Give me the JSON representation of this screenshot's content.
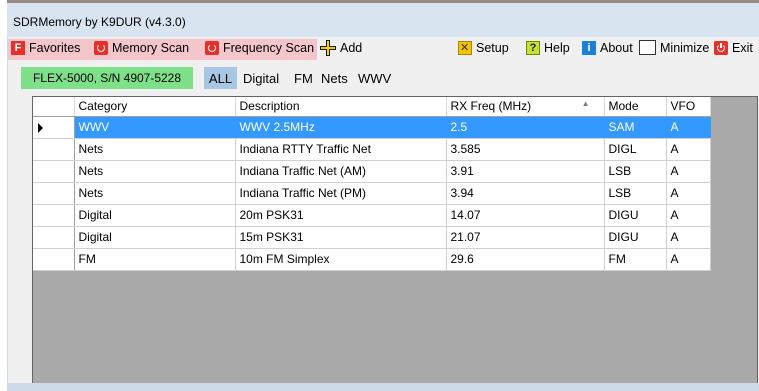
{
  "window": {
    "title": "SDRMemory by K9DUR (v4.3.0)"
  },
  "menu": {
    "favorites": "Favorites",
    "favorites_icon_letter": "F",
    "memory_scan": "Memory Scan",
    "frequency_scan": "Frequency Scan",
    "add": "Add",
    "setup": "Setup",
    "help": "Help",
    "help_icon_letter": "?",
    "about": "About",
    "about_icon_letter": "i",
    "minimize": "Minimize",
    "exit": "Exit"
  },
  "radio": {
    "label": "FLEX-5000, S/N 4907-5228"
  },
  "filters": [
    "ALL",
    "Digital",
    "FM",
    "Nets",
    "WWV"
  ],
  "grid": {
    "columns": [
      "Category",
      "Description",
      "RX Freq (MHz)",
      "Mode",
      "VFO"
    ],
    "sort_indicator": "▲",
    "rows": [
      {
        "category": "WWV",
        "description": "WWV 2.5MHz",
        "rx_freq": "2.5",
        "mode": "SAM",
        "vfo": "A"
      },
      {
        "category": "Nets",
        "description": "Indiana RTTY Traffic Net",
        "rx_freq": "3.585",
        "mode": "DIGL",
        "vfo": "A"
      },
      {
        "category": "Nets",
        "description": "Indiana Traffic Net (AM)",
        "rx_freq": "3.91",
        "mode": "LSB",
        "vfo": "A"
      },
      {
        "category": "Nets",
        "description": "Indiana Traffic Net (PM)",
        "rx_freq": "3.94",
        "mode": "LSB",
        "vfo": "A"
      },
      {
        "category": "Digital",
        "description": "20m PSK31",
        "rx_freq": "14.07",
        "mode": "DIGU",
        "vfo": "A"
      },
      {
        "category": "Digital",
        "description": "15m PSK31",
        "rx_freq": "21.07",
        "mode": "DIGU",
        "vfo": "A"
      },
      {
        "category": "FM",
        "description": "10m FM Simplex",
        "rx_freq": "29.6",
        "mode": "FM",
        "vfo": "A"
      }
    ]
  },
  "colors": {
    "selection": "#3399ff",
    "menu_highlight": "#f5c5cc",
    "radio_label": "#7fe08a",
    "filter_selected": "#a6c6e4"
  }
}
